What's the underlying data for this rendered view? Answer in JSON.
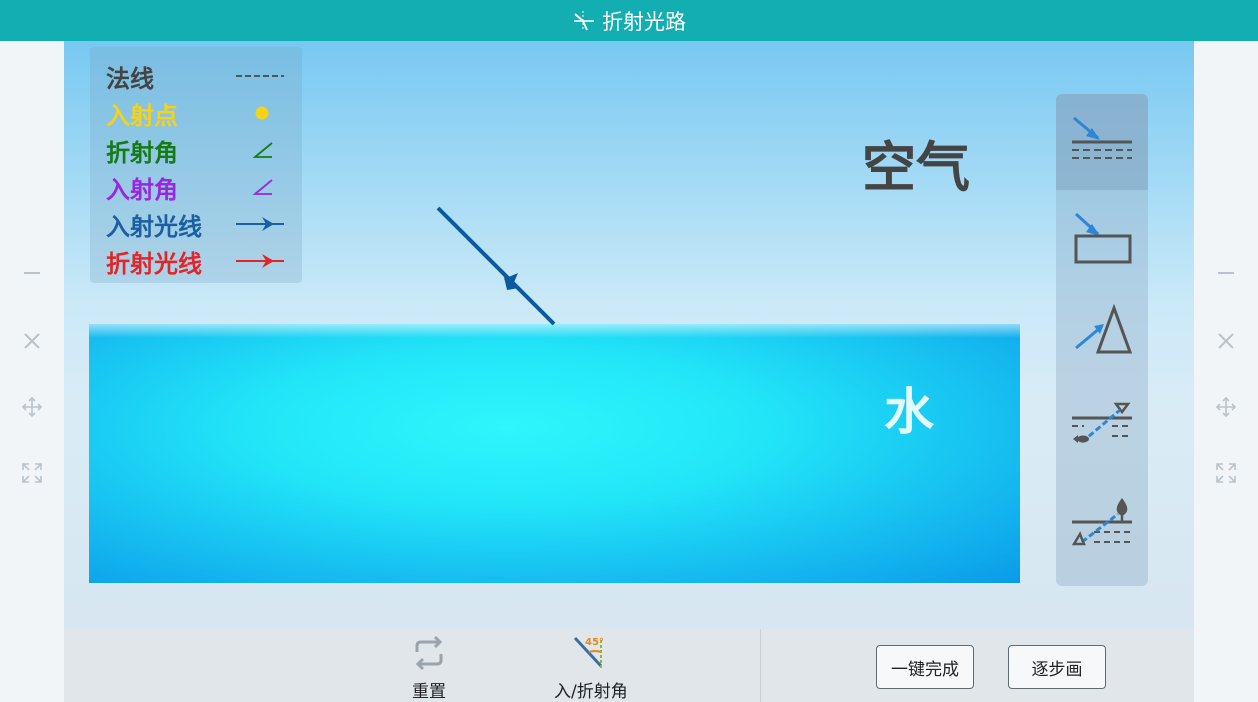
{
  "app": {
    "title": "折射光路",
    "accent_color": "#12aeb1"
  },
  "side_controls": [
    "minimize-icon",
    "close-icon",
    "move-icon",
    "fullscreen-icon"
  ],
  "legend": {
    "items": [
      {
        "label": "法线",
        "color": "#444444",
        "symbol": "dashed-line-icon"
      },
      {
        "label": "入射点",
        "color": "#f7d217",
        "symbol": "dot-icon"
      },
      {
        "label": "折射角",
        "color": "#167b16",
        "symbol": "angle-icon"
      },
      {
        "label": "入射角",
        "color": "#9b26e0",
        "symbol": "angle-icon"
      },
      {
        "label": "入射光线",
        "color": "#1a5fa3",
        "symbol": "arrow-line-icon"
      },
      {
        "label": "折射光线",
        "color": "#e0262a",
        "symbol": "arrow-line-icon"
      }
    ]
  },
  "scene": {
    "air_label": "空气",
    "water_label": "水"
  },
  "tools": [
    {
      "name": "air-to-water-tool",
      "active": true
    },
    {
      "name": "glass-block-tool",
      "active": false
    },
    {
      "name": "prism-tool",
      "active": false
    },
    {
      "name": "fish-view-tool",
      "active": false
    },
    {
      "name": "tree-reflection-tool",
      "active": false
    }
  ],
  "bottom": {
    "reset_label": "重置",
    "angle_label": "入/折射角",
    "angle_badge": "45°",
    "complete_label": "一键完成",
    "step_label": "逐步画"
  }
}
